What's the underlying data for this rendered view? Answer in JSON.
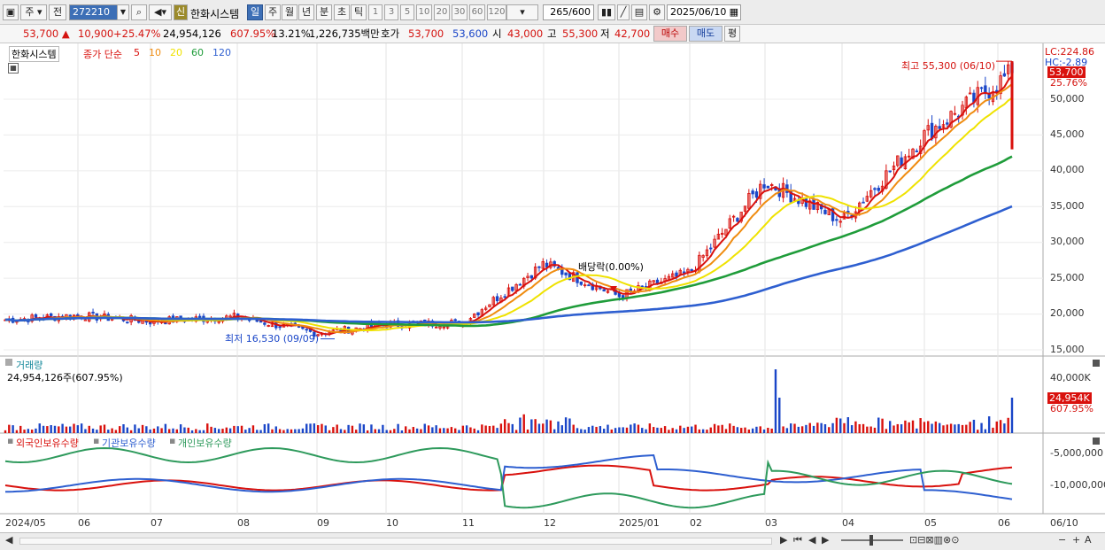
{
  "toolbar": {
    "market": "주",
    "prev": "전",
    "code": "272210",
    "stock_name": "한화시스템",
    "new_badge": "신",
    "periods": [
      "일",
      "주",
      "월",
      "년",
      "분",
      "초",
      "틱"
    ],
    "nums": [
      "1",
      "3",
      "5",
      "10",
      "20",
      "30",
      "60",
      "120"
    ],
    "count": "265",
    "count_max": "/600",
    "date": "2025/06/10"
  },
  "info": {
    "price": "53,700",
    "change_arrow": "▲",
    "change": "10,900",
    "change_pct": "+25.47%",
    "volume": "24,954,126",
    "volume_ratio": "607.95%",
    "turnover": "13.21%",
    "amount": "1,226,735백만",
    "quote_label": "호가",
    "ask": "53,700",
    "bid": "53,600",
    "open_label": "시",
    "open": "43,000",
    "high_label": "고",
    "high": "55,300",
    "low_label": "저",
    "low": "42,700",
    "buy_btn": "매수",
    "sell_btn": "매도",
    "eval_btn": "평"
  },
  "price_panel": {
    "title": "한화시스템",
    "ma_label": "종가 단순",
    "ma_periods": [
      "5",
      "10",
      "20",
      "60",
      "120"
    ],
    "ma_colors": [
      "#d9110d",
      "#ef8c10",
      "#efe200",
      "#1f9c3a",
      "#2e5fd0"
    ],
    "lc": "LC:224.86",
    "hc": "HC:-2.89",
    "current_tag": "53,700",
    "pct_tag": "25.76%",
    "max_label": "최고 55,300 (06/10)",
    "min_label": "최저 16,530 (09/09)",
    "dividend_label": "배당락(0.00%)",
    "y_ticks": [
      "50,000",
      "45,000",
      "40,000",
      "35,000",
      "30,000",
      "25,000",
      "20,000",
      "15,000"
    ]
  },
  "volume_panel": {
    "title": "거래량",
    "value_text": "24,954,126주(607.95%)",
    "y_tick": "40,000K",
    "current_tag": "24,954K",
    "pct_tag": "607.95%"
  },
  "holdings_panel": {
    "series": [
      "외국인보유수량",
      "기관보유수량",
      "개인보유수량"
    ],
    "colors": [
      "#d9110d",
      "#2e5fd0",
      "#2e9a5c"
    ],
    "y_ticks": [
      "-5,000,000",
      "-10,000,000"
    ]
  },
  "x_ticks": [
    "2024/05",
    "06",
    "07",
    "08",
    "09",
    "10",
    "11",
    "12",
    "2025/01",
    "02",
    "03",
    "04",
    "05",
    "06",
    "06/10"
  ],
  "chart_data": {
    "type": "line",
    "title": "한화시스템",
    "x": [
      "2024/05",
      "2024/06",
      "2024/07",
      "2024/08",
      "2024/09",
      "2024/10",
      "2024/11",
      "2024/12",
      "2025/01",
      "2025/02",
      "2025/03",
      "2025/04",
      "2025/05",
      "2025/06/10"
    ],
    "series": [
      {
        "name": "종가",
        "values": [
          19200,
          19800,
          19000,
          19600,
          17300,
          18500,
          18800,
          27000,
          22500,
          25800,
          38500,
          33000,
          45000,
          53700
        ]
      },
      {
        "name": "120",
        "values": [
          17600,
          18000,
          18200,
          18400,
          18500,
          18700,
          19000,
          19900,
          20800,
          22300,
          25200,
          27800,
          30500,
          33300
        ]
      }
    ],
    "ylim": [
      15000,
      55300
    ]
  }
}
